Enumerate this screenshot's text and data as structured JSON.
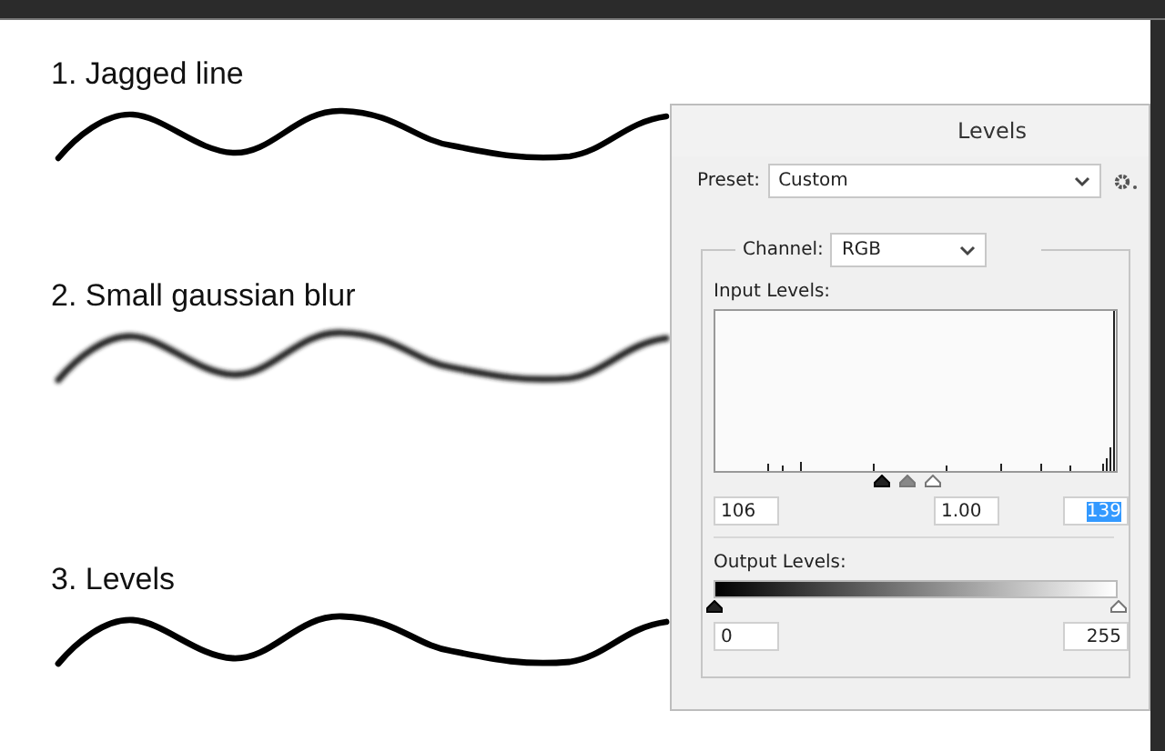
{
  "examples": [
    {
      "label": "1. Jagged line",
      "kind": "jagged"
    },
    {
      "label": "2. Small gaussian blur",
      "kind": "blurred"
    },
    {
      "label": "3. Levels",
      "kind": "leveled"
    }
  ],
  "dialog": {
    "title": "Levels",
    "preset": {
      "label": "Preset:",
      "value": "Custom"
    },
    "channel": {
      "label": "Channel:",
      "value": "RGB"
    },
    "input_levels": {
      "label": "Input Levels:",
      "sliders": [
        {
          "kind": "black",
          "level": 0.416
        },
        {
          "kind": "gray",
          "level": 0.478
        },
        {
          "kind": "white",
          "level": 0.545
        }
      ],
      "fields": [
        {
          "value": "106",
          "selected": false
        },
        {
          "value": "1.00",
          "selected": false
        },
        {
          "value": "139",
          "selected": true
        }
      ]
    },
    "output_levels": {
      "label": "Output Levels:",
      "sliders": [
        {
          "kind": "black",
          "level": 0
        },
        {
          "kind": "white",
          "level": 1
        }
      ],
      "fields": [
        {
          "value": "0",
          "selected": false
        },
        {
          "value": "255",
          "selected": false
        }
      ]
    }
  }
}
